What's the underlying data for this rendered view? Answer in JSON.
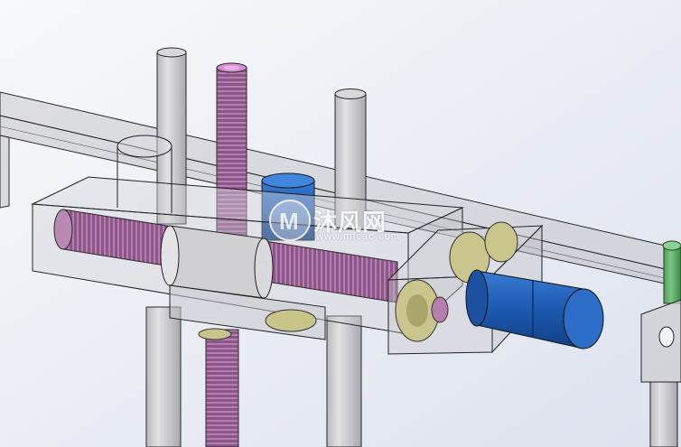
{
  "viewport": {
    "background_top": "#f7f8fb",
    "background_bottom": "#dfe4f0"
  },
  "model": {
    "components": [
      "horizontal-guide-rail",
      "vertical-support-post",
      "threaded-rod-vertical",
      "threaded-rod-horizontal",
      "transparent-housing-block",
      "gear-housing",
      "spur-gear",
      "blue-motor",
      "blue-cylinder-top",
      "green-post",
      "mount-bracket"
    ],
    "colors": {
      "rail": "#c9c9cc",
      "post": "#c4c4c8",
      "thread": "#8e5a8c",
      "thread_light": "#b07aa8",
      "thread_end": "#d58ed3",
      "motor": "#1e5cb3",
      "gear": "#c8c48a",
      "green": "#5fae6a",
      "edge": "#1f1f1f"
    }
  },
  "watermark": {
    "text": "沐风网",
    "url": "www.mfcad.com",
    "logo_letter": "M"
  }
}
